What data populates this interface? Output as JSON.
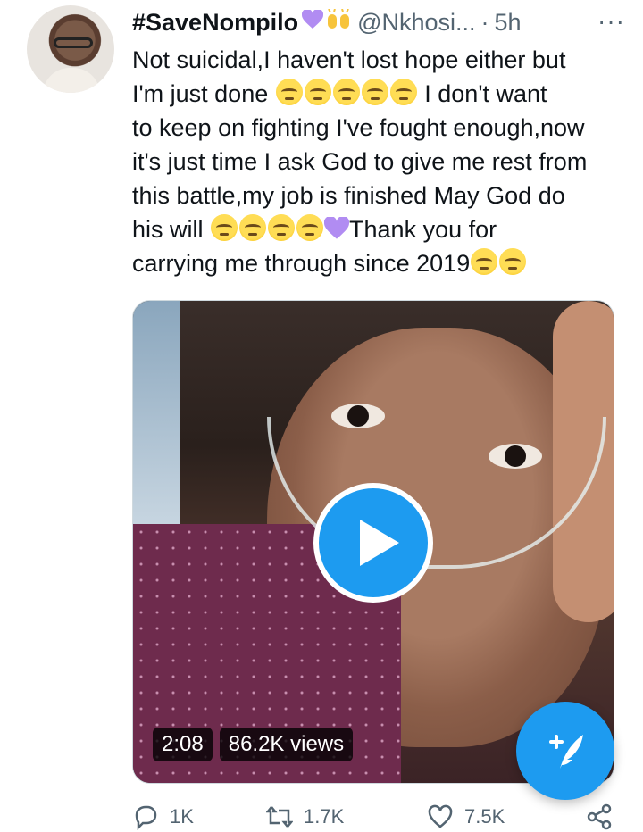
{
  "tweet": {
    "display_name": "#SaveNompilo",
    "handle": "@Nkhosi...",
    "separator": "·",
    "time": "5h",
    "more_label": "···",
    "text_lines": [
      "Not suicidal,I haven't lost hope either but",
      "I'm just done",
      "I don't want",
      "to keep on fighting I've fought enough,now",
      "it's just time I ask God to give me rest from",
      "this battle,my job is finished May God do",
      "his will",
      "Thank you for",
      "carrying me through since 2019"
    ],
    "icons": {
      "name_emojis": [
        "purple-heart-icon",
        "raised-hands-icon"
      ],
      "text_emojis": "face-with-rolling-eyes-icon",
      "heart_emoji": "purple-heart-icon"
    }
  },
  "media": {
    "duration": "2:08",
    "views": "86.2K views",
    "play_icon": "play-icon"
  },
  "actions": {
    "reply_count": "1K",
    "retweet_count": "1.7K",
    "like_count": "7.5K"
  },
  "fab": {
    "icon": "compose-tweet-icon"
  },
  "colors": {
    "accent": "#1d9bf0",
    "text": "#0f1419",
    "secondary": "#536471",
    "purple_heart": "#9b59f5"
  }
}
